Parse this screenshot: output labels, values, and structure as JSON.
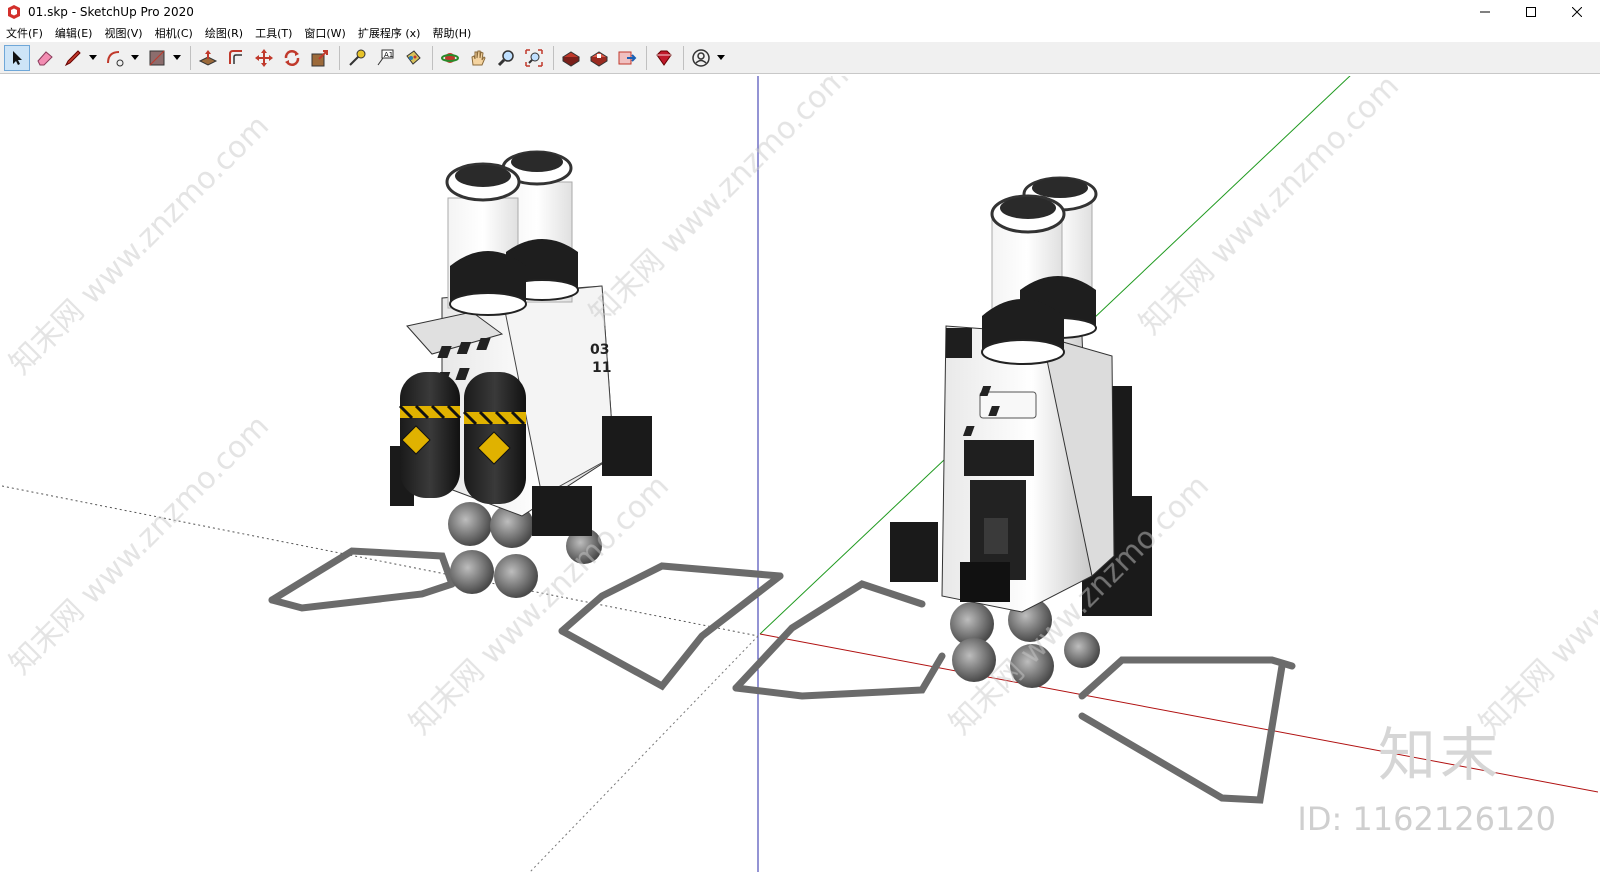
{
  "window": {
    "title": "01.skp - SketchUp Pro 2020",
    "controls": {
      "minimize": "minimize-icon",
      "maximize": "maximize-icon",
      "close": "close-icon"
    }
  },
  "menu": {
    "items": [
      "文件(F)",
      "编辑(E)",
      "视图(V)",
      "相机(C)",
      "绘图(R)",
      "工具(T)",
      "窗口(W)",
      "扩展程序 (x)",
      "帮助(H)"
    ]
  },
  "toolbar": {
    "tools": [
      "select-icon",
      "eraser-icon",
      "pencil-line-icon",
      "arc-icon",
      "rectangle-icon",
      "push-pull-icon",
      "offset-icon",
      "move-icon",
      "rotate-icon",
      "scale-icon",
      "tape-measure-icon",
      "text-icon",
      "paint-bucket-icon",
      "orbit-icon",
      "pan-icon",
      "zoom-icon",
      "zoom-extents-icon",
      "warehouse-icon",
      "extension-warehouse-icon",
      "send-to-layout-icon",
      "ruby-extension-icon",
      "account-icon"
    ],
    "active_tool": "select-icon"
  },
  "viewport": {
    "axis_colors": {
      "red": "#c00000",
      "green": "#00a000",
      "blue": "#0000c0"
    },
    "split_views": 2
  },
  "watermark": {
    "brand": "知末",
    "id_text": "ID: 1162126120",
    "diagonal_text": "知末网 www.znzmo.com"
  }
}
